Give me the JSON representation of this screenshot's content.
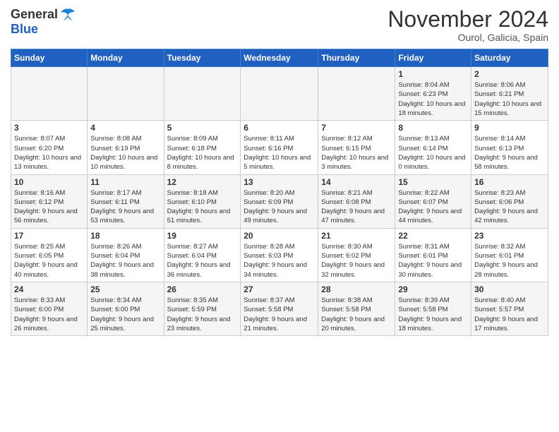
{
  "header": {
    "logo": {
      "general": "General",
      "blue": "Blue"
    },
    "title": "November 2024",
    "location": "Ourol, Galicia, Spain"
  },
  "weekdays": [
    "Sunday",
    "Monday",
    "Tuesday",
    "Wednesday",
    "Thursday",
    "Friday",
    "Saturday"
  ],
  "weeks": [
    [
      {
        "day": "",
        "info": ""
      },
      {
        "day": "",
        "info": ""
      },
      {
        "day": "",
        "info": ""
      },
      {
        "day": "",
        "info": ""
      },
      {
        "day": "",
        "info": ""
      },
      {
        "day": "1",
        "info": "Sunrise: 8:04 AM\nSunset: 6:23 PM\nDaylight: 10 hours and 18 minutes."
      },
      {
        "day": "2",
        "info": "Sunrise: 8:06 AM\nSunset: 6:21 PM\nDaylight: 10 hours and 15 minutes."
      }
    ],
    [
      {
        "day": "3",
        "info": "Sunrise: 8:07 AM\nSunset: 6:20 PM\nDaylight: 10 hours and 13 minutes."
      },
      {
        "day": "4",
        "info": "Sunrise: 8:08 AM\nSunset: 6:19 PM\nDaylight: 10 hours and 10 minutes."
      },
      {
        "day": "5",
        "info": "Sunrise: 8:09 AM\nSunset: 6:18 PM\nDaylight: 10 hours and 8 minutes."
      },
      {
        "day": "6",
        "info": "Sunrise: 8:11 AM\nSunset: 6:16 PM\nDaylight: 10 hours and 5 minutes."
      },
      {
        "day": "7",
        "info": "Sunrise: 8:12 AM\nSunset: 6:15 PM\nDaylight: 10 hours and 3 minutes."
      },
      {
        "day": "8",
        "info": "Sunrise: 8:13 AM\nSunset: 6:14 PM\nDaylight: 10 hours and 0 minutes."
      },
      {
        "day": "9",
        "info": "Sunrise: 8:14 AM\nSunset: 6:13 PM\nDaylight: 9 hours and 58 minutes."
      }
    ],
    [
      {
        "day": "10",
        "info": "Sunrise: 8:16 AM\nSunset: 6:12 PM\nDaylight: 9 hours and 56 minutes."
      },
      {
        "day": "11",
        "info": "Sunrise: 8:17 AM\nSunset: 6:11 PM\nDaylight: 9 hours and 53 minutes."
      },
      {
        "day": "12",
        "info": "Sunrise: 8:18 AM\nSunset: 6:10 PM\nDaylight: 9 hours and 51 minutes."
      },
      {
        "day": "13",
        "info": "Sunrise: 8:20 AM\nSunset: 6:09 PM\nDaylight: 9 hours and 49 minutes."
      },
      {
        "day": "14",
        "info": "Sunrise: 8:21 AM\nSunset: 6:08 PM\nDaylight: 9 hours and 47 minutes."
      },
      {
        "day": "15",
        "info": "Sunrise: 8:22 AM\nSunset: 6:07 PM\nDaylight: 9 hours and 44 minutes."
      },
      {
        "day": "16",
        "info": "Sunrise: 8:23 AM\nSunset: 6:06 PM\nDaylight: 9 hours and 42 minutes."
      }
    ],
    [
      {
        "day": "17",
        "info": "Sunrise: 8:25 AM\nSunset: 6:05 PM\nDaylight: 9 hours and 40 minutes."
      },
      {
        "day": "18",
        "info": "Sunrise: 8:26 AM\nSunset: 6:04 PM\nDaylight: 9 hours and 38 minutes."
      },
      {
        "day": "19",
        "info": "Sunrise: 8:27 AM\nSunset: 6:04 PM\nDaylight: 9 hours and 36 minutes."
      },
      {
        "day": "20",
        "info": "Sunrise: 8:28 AM\nSunset: 6:03 PM\nDaylight: 9 hours and 34 minutes."
      },
      {
        "day": "21",
        "info": "Sunrise: 8:30 AM\nSunset: 6:02 PM\nDaylight: 9 hours and 32 minutes."
      },
      {
        "day": "22",
        "info": "Sunrise: 8:31 AM\nSunset: 6:01 PM\nDaylight: 9 hours and 30 minutes."
      },
      {
        "day": "23",
        "info": "Sunrise: 8:32 AM\nSunset: 6:01 PM\nDaylight: 9 hours and 28 minutes."
      }
    ],
    [
      {
        "day": "24",
        "info": "Sunrise: 8:33 AM\nSunset: 6:00 PM\nDaylight: 9 hours and 26 minutes."
      },
      {
        "day": "25",
        "info": "Sunrise: 8:34 AM\nSunset: 6:00 PM\nDaylight: 9 hours and 25 minutes."
      },
      {
        "day": "26",
        "info": "Sunrise: 8:35 AM\nSunset: 5:59 PM\nDaylight: 9 hours and 23 minutes."
      },
      {
        "day": "27",
        "info": "Sunrise: 8:37 AM\nSunset: 5:58 PM\nDaylight: 9 hours and 21 minutes."
      },
      {
        "day": "28",
        "info": "Sunrise: 8:38 AM\nSunset: 5:58 PM\nDaylight: 9 hours and 20 minutes."
      },
      {
        "day": "29",
        "info": "Sunrise: 8:39 AM\nSunset: 5:58 PM\nDaylight: 9 hours and 18 minutes."
      },
      {
        "day": "30",
        "info": "Sunrise: 8:40 AM\nSunset: 5:57 PM\nDaylight: 9 hours and 17 minutes."
      }
    ]
  ]
}
